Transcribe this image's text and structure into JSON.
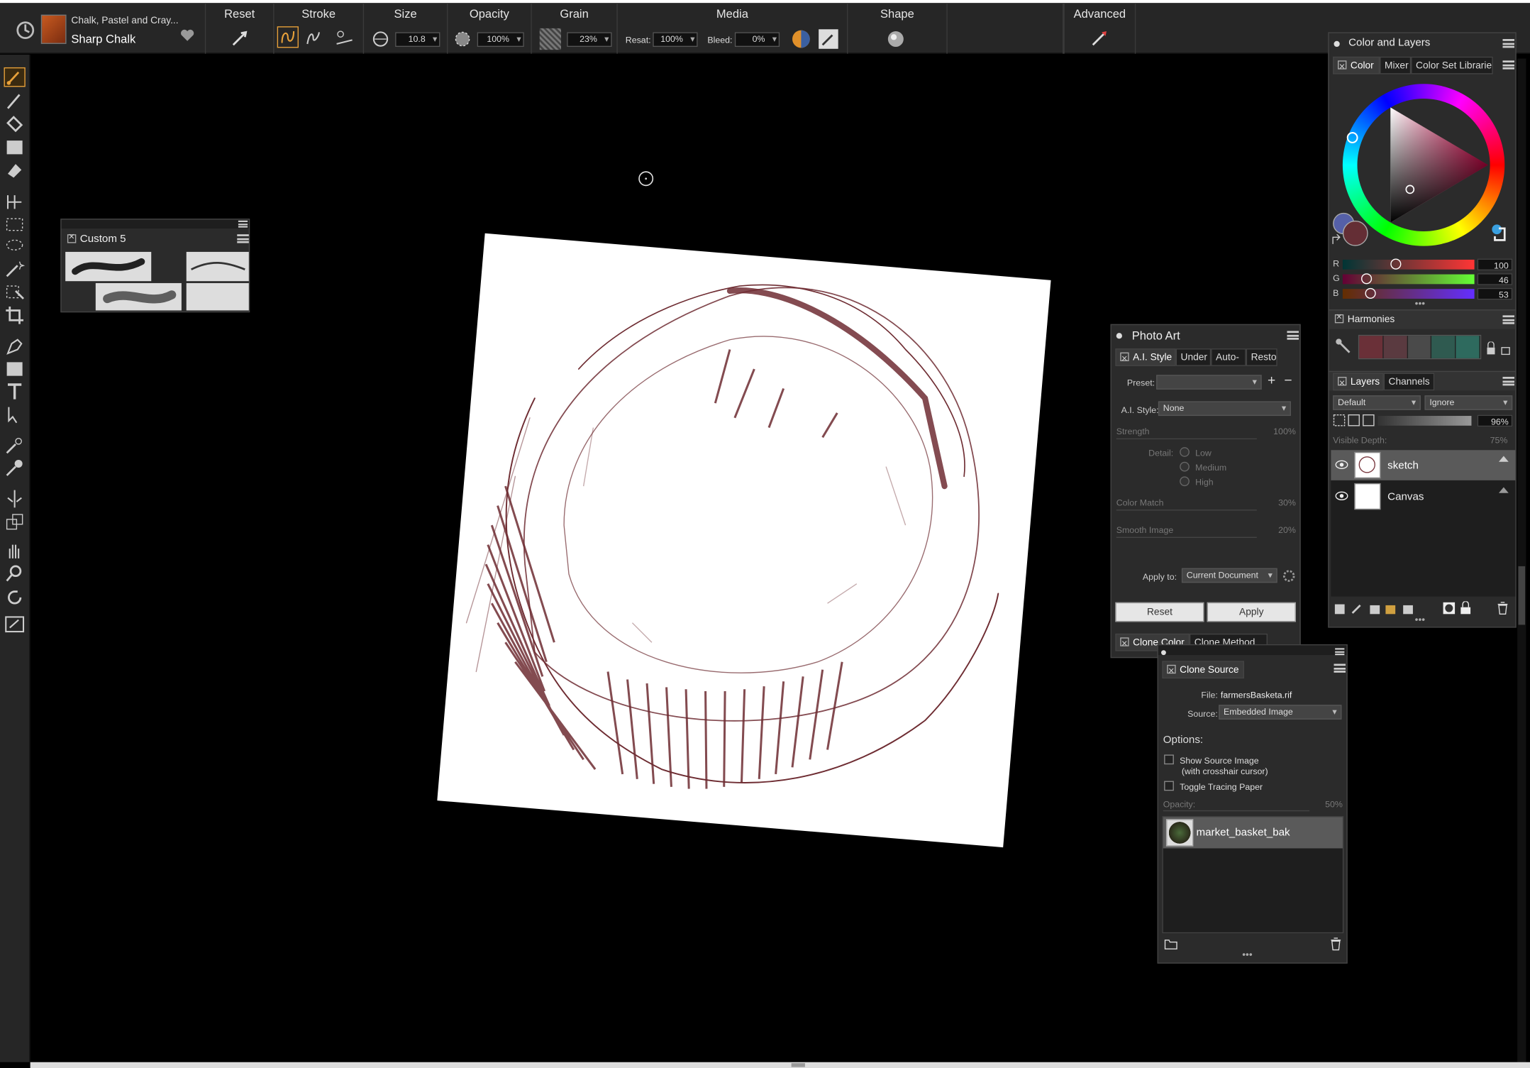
{
  "brush": {
    "category": "Chalk, Pastel and Cray...",
    "variant": "Sharp Chalk"
  },
  "propbar": {
    "reset": "Reset",
    "stroke": "Stroke",
    "size": "Size",
    "size_value": "10.8",
    "opacity": "Opacity",
    "opacity_value": "100%",
    "grain": "Grain",
    "grain_value": "23%",
    "media": "Media",
    "resat_label": "Resat:",
    "resat_value": "100%",
    "bleed_label": "Bleed:",
    "bleed_value": "0%",
    "shape": "Shape",
    "advanced": "Advanced"
  },
  "custom_palette": {
    "title": "Custom 5"
  },
  "color_layers": {
    "title": "Color and Layers",
    "tabs": [
      "Color",
      "Mixer",
      "Color Set Libraries"
    ],
    "r_label": "R",
    "r_value": "100",
    "g_label": "G",
    "g_value": "46",
    "b_label": "B",
    "b_value": "53",
    "r_fraction": 0.4,
    "g_fraction": 0.18,
    "b_fraction": 0.21,
    "primary_color": "#642e35",
    "harmonies_title": "Harmonies",
    "harmony_swatches": [
      "#6a3038",
      "#5a3a40",
      "#4a4a4a",
      "#2f5a50",
      "#2e6a5e"
    ],
    "layers_tab": "Layers",
    "channels_tab": "Channels",
    "composite_method": "Default",
    "composite_depth": "Ignore",
    "opacity_value": "96%",
    "visible_depth_label": "Visible Depth:",
    "visible_depth_value": "75%",
    "layers": [
      {
        "name": "sketch"
      },
      {
        "name": "Canvas"
      }
    ]
  },
  "photo_art": {
    "title": "Photo Art",
    "tabs": [
      "A.I. Style",
      "Under",
      "Auto-",
      "Resto"
    ],
    "preset_label": "Preset:",
    "ai_style_label": "A.I. Style:",
    "ai_style_value": "None",
    "strength_label": "Strength",
    "strength_value": "100%",
    "detail_label": "Detail:",
    "detail_options": [
      "Low",
      "Medium",
      "High"
    ],
    "color_match_label": "Color Match",
    "color_match_value": "30%",
    "smooth_image_label": "Smooth Image",
    "smooth_image_value": "20%",
    "apply_to_label": "Apply to:",
    "apply_to_value": "Current Document",
    "reset_button": "Reset",
    "apply_button": "Apply",
    "bottom_tabs": [
      "Clone Color",
      "Clone Method"
    ]
  },
  "clone_source": {
    "title": "Clone Source",
    "file_label": "File:",
    "file_value": "farmersBasketa.rif",
    "source_label": "Source:",
    "source_value": "Embedded Image",
    "options_label": "Options:",
    "show_source_line1": "Show Source Image",
    "show_source_line2": "(with crosshair cursor)",
    "tracing_paper": "Toggle Tracing Paper",
    "opacity_label": "Opacity:",
    "opacity_value": "50%",
    "sources": [
      {
        "name": "market_basket_bak"
      }
    ]
  },
  "colors": {
    "accent": "#e8a13a",
    "sketch_stroke": "#6e2c32",
    "panel": "#2b2b2b"
  }
}
